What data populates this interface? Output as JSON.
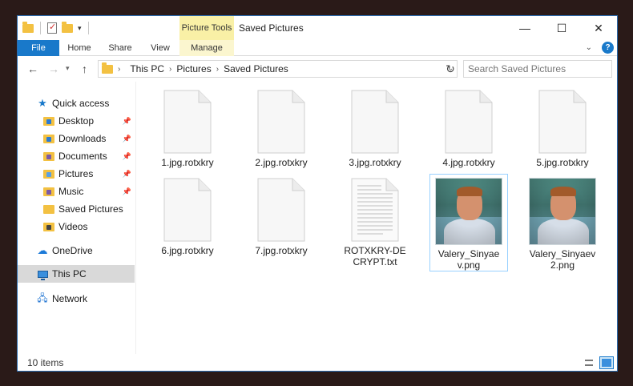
{
  "window": {
    "title": "Saved Pictures",
    "picture_tools_label": "Picture Tools"
  },
  "window_buttons": {
    "minimize": "—",
    "maximize": "☐",
    "close": "✕"
  },
  "ribbon": {
    "tabs": [
      {
        "label": "File"
      },
      {
        "label": "Home"
      },
      {
        "label": "Share"
      },
      {
        "label": "View"
      },
      {
        "label": "Manage"
      }
    ],
    "help": "?",
    "expand": "⌄"
  },
  "address": {
    "crumbs": [
      "This PC",
      "Pictures",
      "Saved Pictures"
    ],
    "search_placeholder": "Search Saved Pictures"
  },
  "nav": {
    "quick_access": "Quick access",
    "items": [
      {
        "label": "Desktop",
        "pinned": true
      },
      {
        "label": "Downloads",
        "pinned": true
      },
      {
        "label": "Documents",
        "pinned": true
      },
      {
        "label": "Pictures",
        "pinned": true
      },
      {
        "label": "Music",
        "pinned": true
      },
      {
        "label": "Saved Pictures",
        "pinned": false
      },
      {
        "label": "Videos",
        "pinned": false
      }
    ],
    "onedrive": "OneDrive",
    "this_pc": "This PC",
    "network": "Network"
  },
  "files": [
    {
      "name": "1.jpg.rotxkry",
      "type": "blank"
    },
    {
      "name": "2.jpg.rotxkry",
      "type": "blank"
    },
    {
      "name": "3.jpg.rotxkry",
      "type": "blank"
    },
    {
      "name": "4.jpg.rotxkry",
      "type": "blank"
    },
    {
      "name": "5.jpg.rotxkry",
      "type": "blank"
    },
    {
      "name": "6.jpg.rotxkry",
      "type": "blank"
    },
    {
      "name": "7.jpg.rotxkry",
      "type": "blank"
    },
    {
      "name": "ROTXKRY-DECRYPT.txt",
      "type": "text"
    },
    {
      "name": "Valery_Sinyaev.png",
      "type": "image",
      "selected": true
    },
    {
      "name": "Valery_Sinyaev2.png",
      "type": "image"
    }
  ],
  "status": {
    "item_count": "10 items"
  },
  "colors": {
    "accent": "#1979ca",
    "picture_tools": "#f9f0a6",
    "folder": "#f3c142"
  }
}
